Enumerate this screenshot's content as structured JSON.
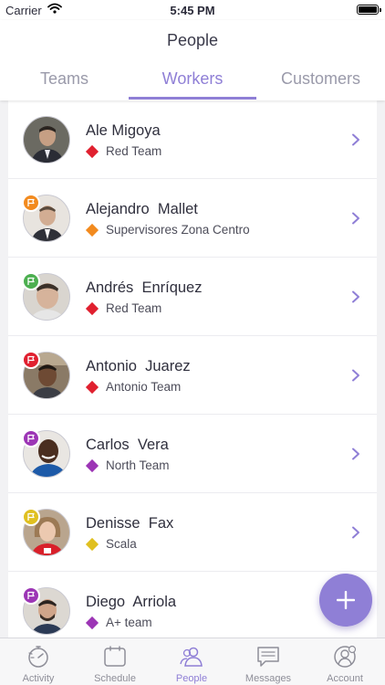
{
  "status_bar": {
    "carrier": "Carrier",
    "time": "5:45 PM"
  },
  "header": {
    "title": "People",
    "tabs": [
      {
        "label": "Teams",
        "active": false
      },
      {
        "label": "Workers",
        "active": true
      },
      {
        "label": "Customers",
        "active": false
      }
    ]
  },
  "workers": [
    {
      "name": "Ale Migoya",
      "team": "Red Team",
      "team_color": "#e0202f",
      "flag_color": null
    },
    {
      "name": "Alejandro  Mallet",
      "team": "Supervisores Zona Centro",
      "team_color": "#f28a1e",
      "flag_color": "#f28a1e"
    },
    {
      "name": "Andrés  Enríquez",
      "team": "Red Team",
      "team_color": "#e0202f",
      "flag_color": "#4caf50"
    },
    {
      "name": "Antonio  Juarez",
      "team": "Antonio Team",
      "team_color": "#e0202f",
      "flag_color": "#e0202f"
    },
    {
      "name": "Carlos  Vera",
      "team": "North Team",
      "team_color": "#9c35b5",
      "flag_color": "#9c35b5"
    },
    {
      "name": "Denisse  Fax",
      "team": "Scala",
      "team_color": "#e0c020",
      "flag_color": "#e0c020"
    },
    {
      "name": "Diego  Arriola",
      "team": "A+ team",
      "team_color": "#9c35b5",
      "flag_color": "#9c35b5"
    }
  ],
  "tab_bar": [
    {
      "label": "Activity",
      "icon": "activity-icon",
      "active": false
    },
    {
      "label": "Schedule",
      "icon": "schedule-icon",
      "active": false
    },
    {
      "label": "People",
      "icon": "people-icon",
      "active": true
    },
    {
      "label": "Messages",
      "icon": "messages-icon",
      "active": false
    },
    {
      "label": "Account",
      "icon": "account-icon",
      "active": false
    }
  ],
  "colors": {
    "accent": "#8f7fd6",
    "inactive": "#9a9aaa"
  }
}
